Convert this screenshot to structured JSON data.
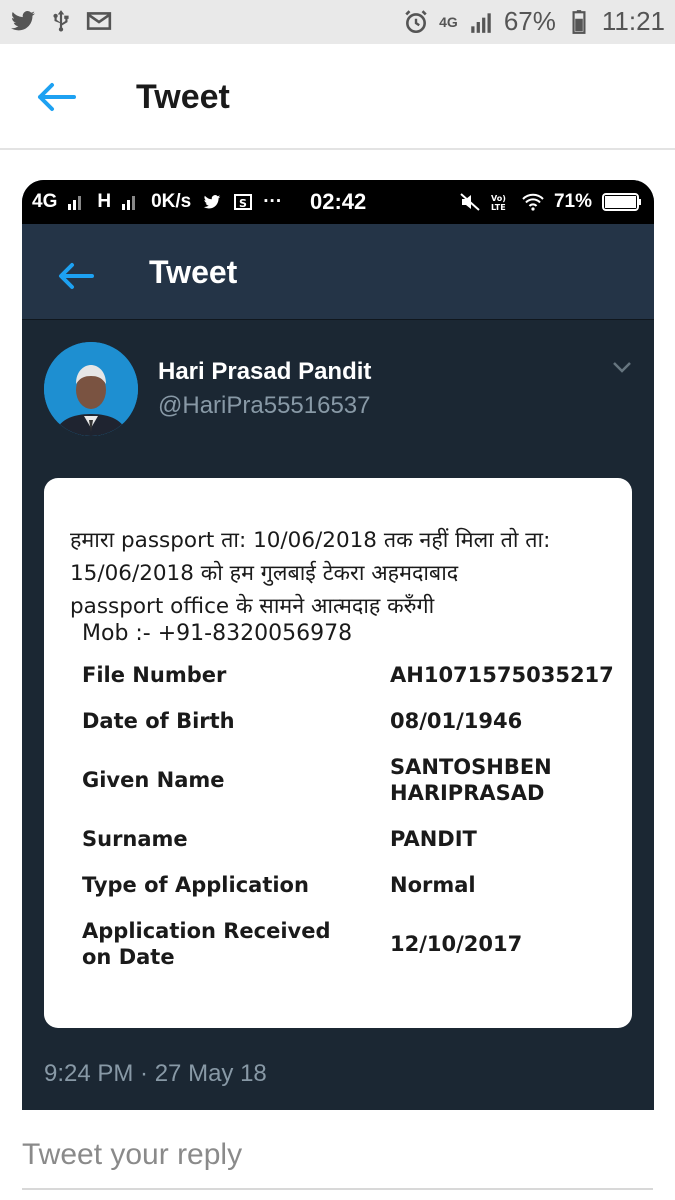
{
  "status_bar": {
    "signal_label": "4G",
    "battery": "67%",
    "time": "11:21"
  },
  "header": {
    "title": "Tweet"
  },
  "embedded": {
    "status_bar": {
      "net1": "4G",
      "net2": "H",
      "speed": "0K/s",
      "time": "02:42",
      "battery": "71%"
    },
    "header": {
      "title": "Tweet"
    },
    "user": {
      "name": "Hari Prasad Pandit",
      "handle": "@HariPra55516537"
    },
    "document": {
      "message_lines": [
        "हमारा passport ता: 10/06/2018 तक नहीं मिला तो ता:",
        "15/06/2018 को हम  गुलबाई टेकरा अहमदाबाद",
        "passport office  के सामने आत्मदाह करुँगी"
      ],
      "mobile": "Mob :- +91-8320056978",
      "rows": [
        {
          "key": "File Number",
          "value": "AH1071575035217"
        },
        {
          "key": "Date of Birth",
          "value": "08/01/1946"
        },
        {
          "key": "Given Name",
          "value": "SANTOSHBEN HARIPRASAD"
        },
        {
          "key": "Surname",
          "value": "PANDIT"
        },
        {
          "key": "Type of Application",
          "value": "Normal"
        },
        {
          "key": "Application Received on Date",
          "value": "12/10/2017"
        }
      ]
    },
    "timestamp": "9:24 PM · 27 May 18"
  },
  "reply": {
    "placeholder": "Tweet your reply"
  },
  "colors": {
    "accent": "#1da1f2",
    "dark_bg": "#1b2733",
    "dark_header": "#243447",
    "muted": "#8899a6"
  }
}
